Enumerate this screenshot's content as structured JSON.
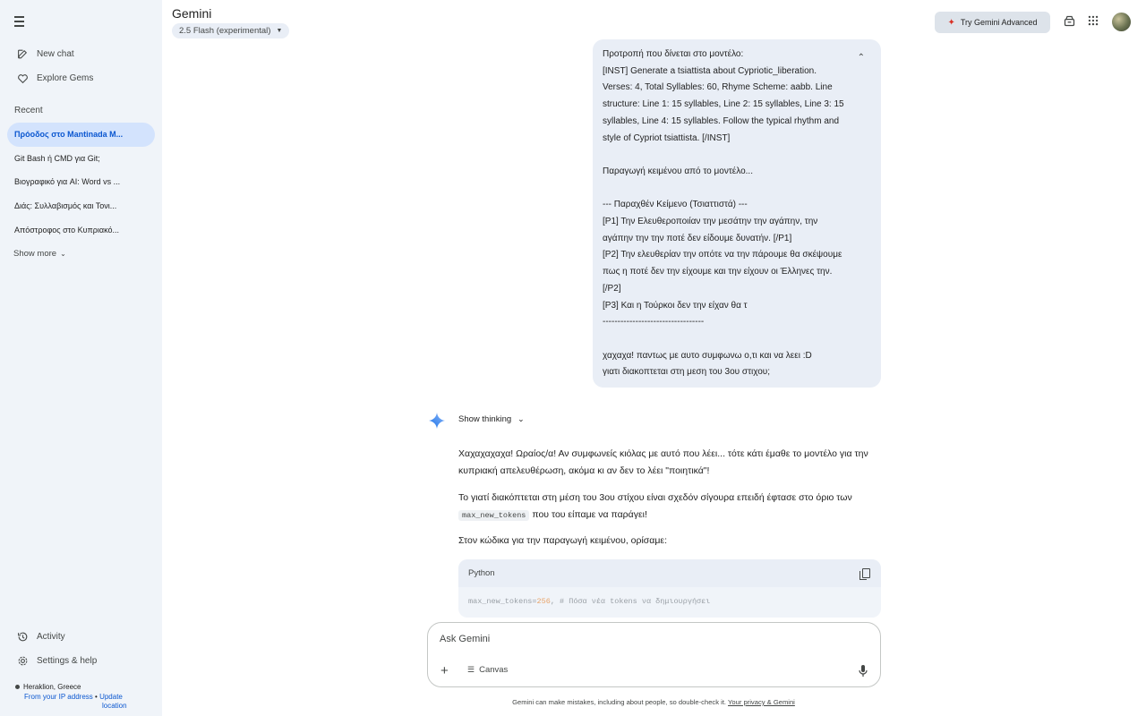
{
  "sidebar": {
    "new_chat": "New chat",
    "explore_gems": "Explore Gems",
    "recent_label": "Recent",
    "recent": [
      "Πρόοδος στο Mantinada M...",
      "Git Bash ή CMD για Git;",
      "Βιογραφικό για AI: Word vs ...",
      "Διάς: Συλλαβισμός και Τονι...",
      "Απόστροφος στο Κυπριακό..."
    ],
    "show_more": "Show more",
    "activity": "Activity",
    "settings": "Settings & help",
    "location": {
      "place": "Heraklion, Greece",
      "from_ip": "From your IP address",
      "separator": "•",
      "update": "Update",
      "update2": "location"
    }
  },
  "header": {
    "brand": "Gemini",
    "model": "2.5 Flash (experimental)",
    "try_advanced": "Try Gemini Advanced"
  },
  "user_message": {
    "paragraphs": [
      "Προτροπή που δίνεται στο μοντέλο:\n[INST] Generate a tsiattista about Cypriotic_liberation. Verses: 4, Total Syllables: 60, Rhyme Scheme: aabb. Line structure: Line 1: 15 syllables, Line 2: 15 syllables, Line 3: 15 syllables, Line 4: 15 syllables. Follow the typical rhythm and style of Cypriot tsiattista. [/INST]",
      "Παραγωγή κειμένου από το μοντέλο...",
      "--- Παραχθέν Κείμενο (Τσιαττιστά) ---\n[P1] Την Ελευθεροποιίαν την μεσάτην την αγάπην, την αγάπην την την ποτέ δεν είδουμε δυνατήν. [/P1]\n[P2] Την ελευθερίαν την οπότε να την πάρουμε θα σκέψουμε πως η ποτέ δεν την είχουμε και την είχουν οι Έλληνες την. [/P2]\n[P3] Και η Τούρκοι δεν την είχαν θα τ\n----------------------------------",
      "χαχαχα! παντως με αυτο συμφωνω ο,τι και να λεει :D\nγιατι διακοπτεται στη μεση του 3ου στιχου;"
    ]
  },
  "response": {
    "show_thinking": "Show thinking",
    "p1": "Χαχαχαχαχα! Ωραίος/α! Αν συμφωνείς κιόλας με αυτό που λέει... τότε κάτι έμαθε το μοντέλο για την κυπριακή απελευθέρωση, ακόμα κι αν δεν το λέει \"ποιητικά\"!",
    "p2_a": "Το γιατί διακόπτεται στη μέση του 3ου στίχου είναι σχεδόν σίγουρα επειδή έφτασε στο όριο των",
    "p2_code": "max_new_tokens",
    "p2_b": "που του είπαμε να παράγει!",
    "p3": "Στον κώδικα για την παραγωγή κειμένου, ορίσαμε:",
    "code_lang": "Python",
    "code_a": "max_new_tokens=",
    "code_num": "256",
    "code_b": ", # Πόσα νέα tokens να δημιουργήσει"
  },
  "input": {
    "placeholder": "Ask Gemini",
    "canvas": "Canvas"
  },
  "footer": {
    "disclaimer": "Gemini can make mistakes, including about people, so double-check it.",
    "privacy": "Your privacy & Gemini"
  },
  "colors": {
    "sidebar_bg": "#f0f4f9",
    "active_bg": "#d3e3fd",
    "accent": "#0b57d0",
    "bubble_bg": "#e9eef6"
  }
}
